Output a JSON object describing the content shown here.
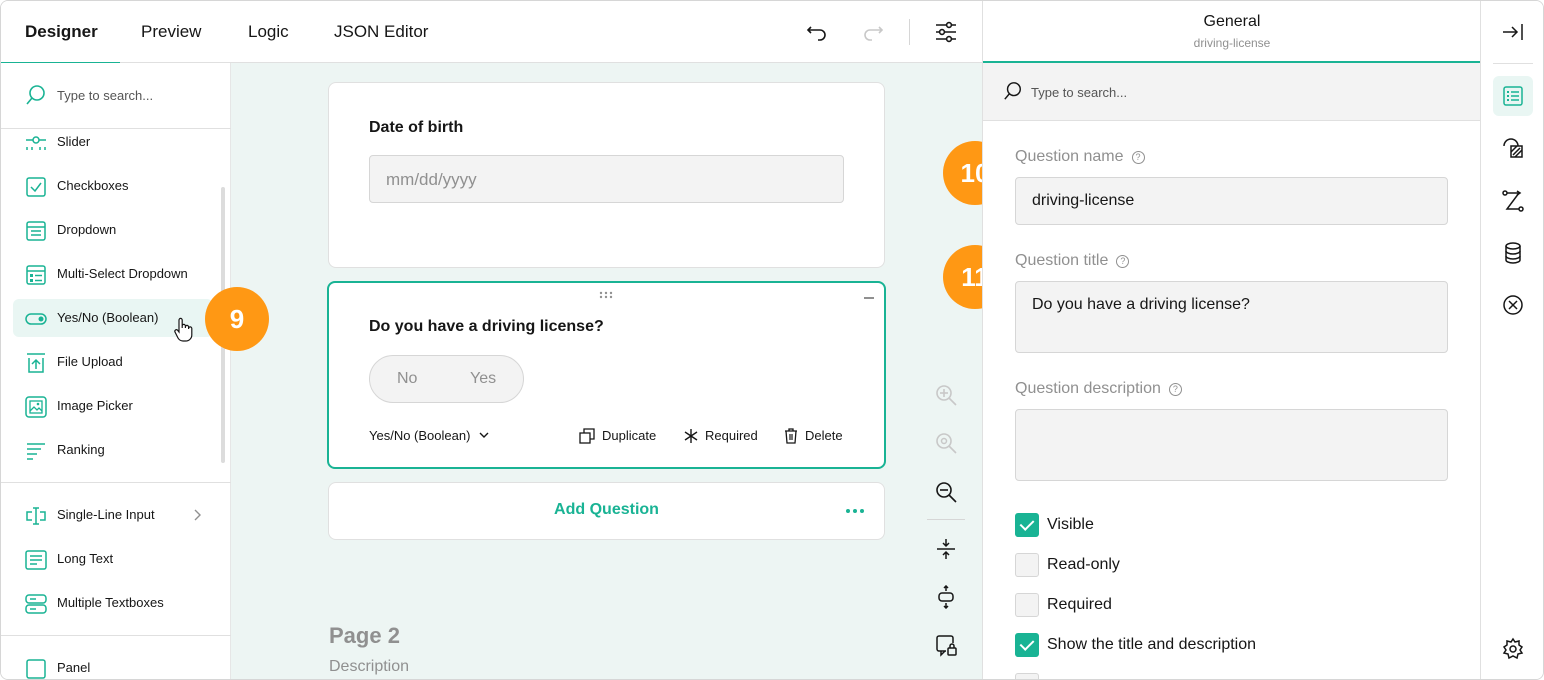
{
  "tabs": [
    {
      "label": "Designer",
      "active": true
    },
    {
      "label": "Preview",
      "active": false
    },
    {
      "label": "Logic",
      "active": false
    },
    {
      "label": "JSON Editor",
      "active": false
    }
  ],
  "toolbox": {
    "search_placeholder": "Type to search...",
    "items": [
      {
        "label": "Slider",
        "icon": "slider-icon"
      },
      {
        "label": "Checkboxes",
        "icon": "checkbox-icon"
      },
      {
        "label": "Dropdown",
        "icon": "dropdown-icon"
      },
      {
        "label": "Multi-Select Dropdown",
        "icon": "multiselect-dropdown-icon"
      },
      {
        "label": "Yes/No (Boolean)",
        "icon": "toggle-icon"
      },
      {
        "label": "File Upload",
        "icon": "file-upload-icon"
      },
      {
        "label": "Image Picker",
        "icon": "image-picker-icon"
      },
      {
        "label": "Ranking",
        "icon": "ranking-icon"
      },
      {
        "label": "Single-Line Input",
        "icon": "text-input-icon"
      },
      {
        "label": "Long Text",
        "icon": "long-text-icon"
      },
      {
        "label": "Multiple Textboxes",
        "icon": "multiple-textboxes-icon"
      },
      {
        "label": "Panel",
        "icon": "panel-icon"
      }
    ]
  },
  "canvas": {
    "q1": {
      "title": "Date of birth",
      "placeholder": "mm/dd/yyyy"
    },
    "q2": {
      "title": "Do you have a driving license?",
      "no_label": "No",
      "yes_label": "Yes",
      "type_label": "Yes/No (Boolean)",
      "duplicate_label": "Duplicate",
      "required_label": "Required",
      "delete_label": "Delete"
    },
    "add_question_label": "Add Question",
    "page2_title": "Page 2",
    "page2_description": "Description"
  },
  "badges": {
    "b9": "9",
    "b10": "10",
    "b11": "11"
  },
  "properties": {
    "category": "General",
    "object_name": "driving-license",
    "search_placeholder": "Type to search...",
    "name_label": "Question name",
    "name_value": "driving-license",
    "title_label": "Question title",
    "title_value": "Do you have a driving license?",
    "description_label": "Question description",
    "description_value": "",
    "checkboxes": [
      {
        "label": "Visible",
        "checked": true
      },
      {
        "label": "Read-only",
        "checked": false
      },
      {
        "label": "Required",
        "checked": false
      },
      {
        "label": "Show the title and description",
        "checked": true
      }
    ]
  },
  "colors": {
    "accent": "#19b394",
    "badge": "#ff9814",
    "canvas": "#edf5f3"
  }
}
